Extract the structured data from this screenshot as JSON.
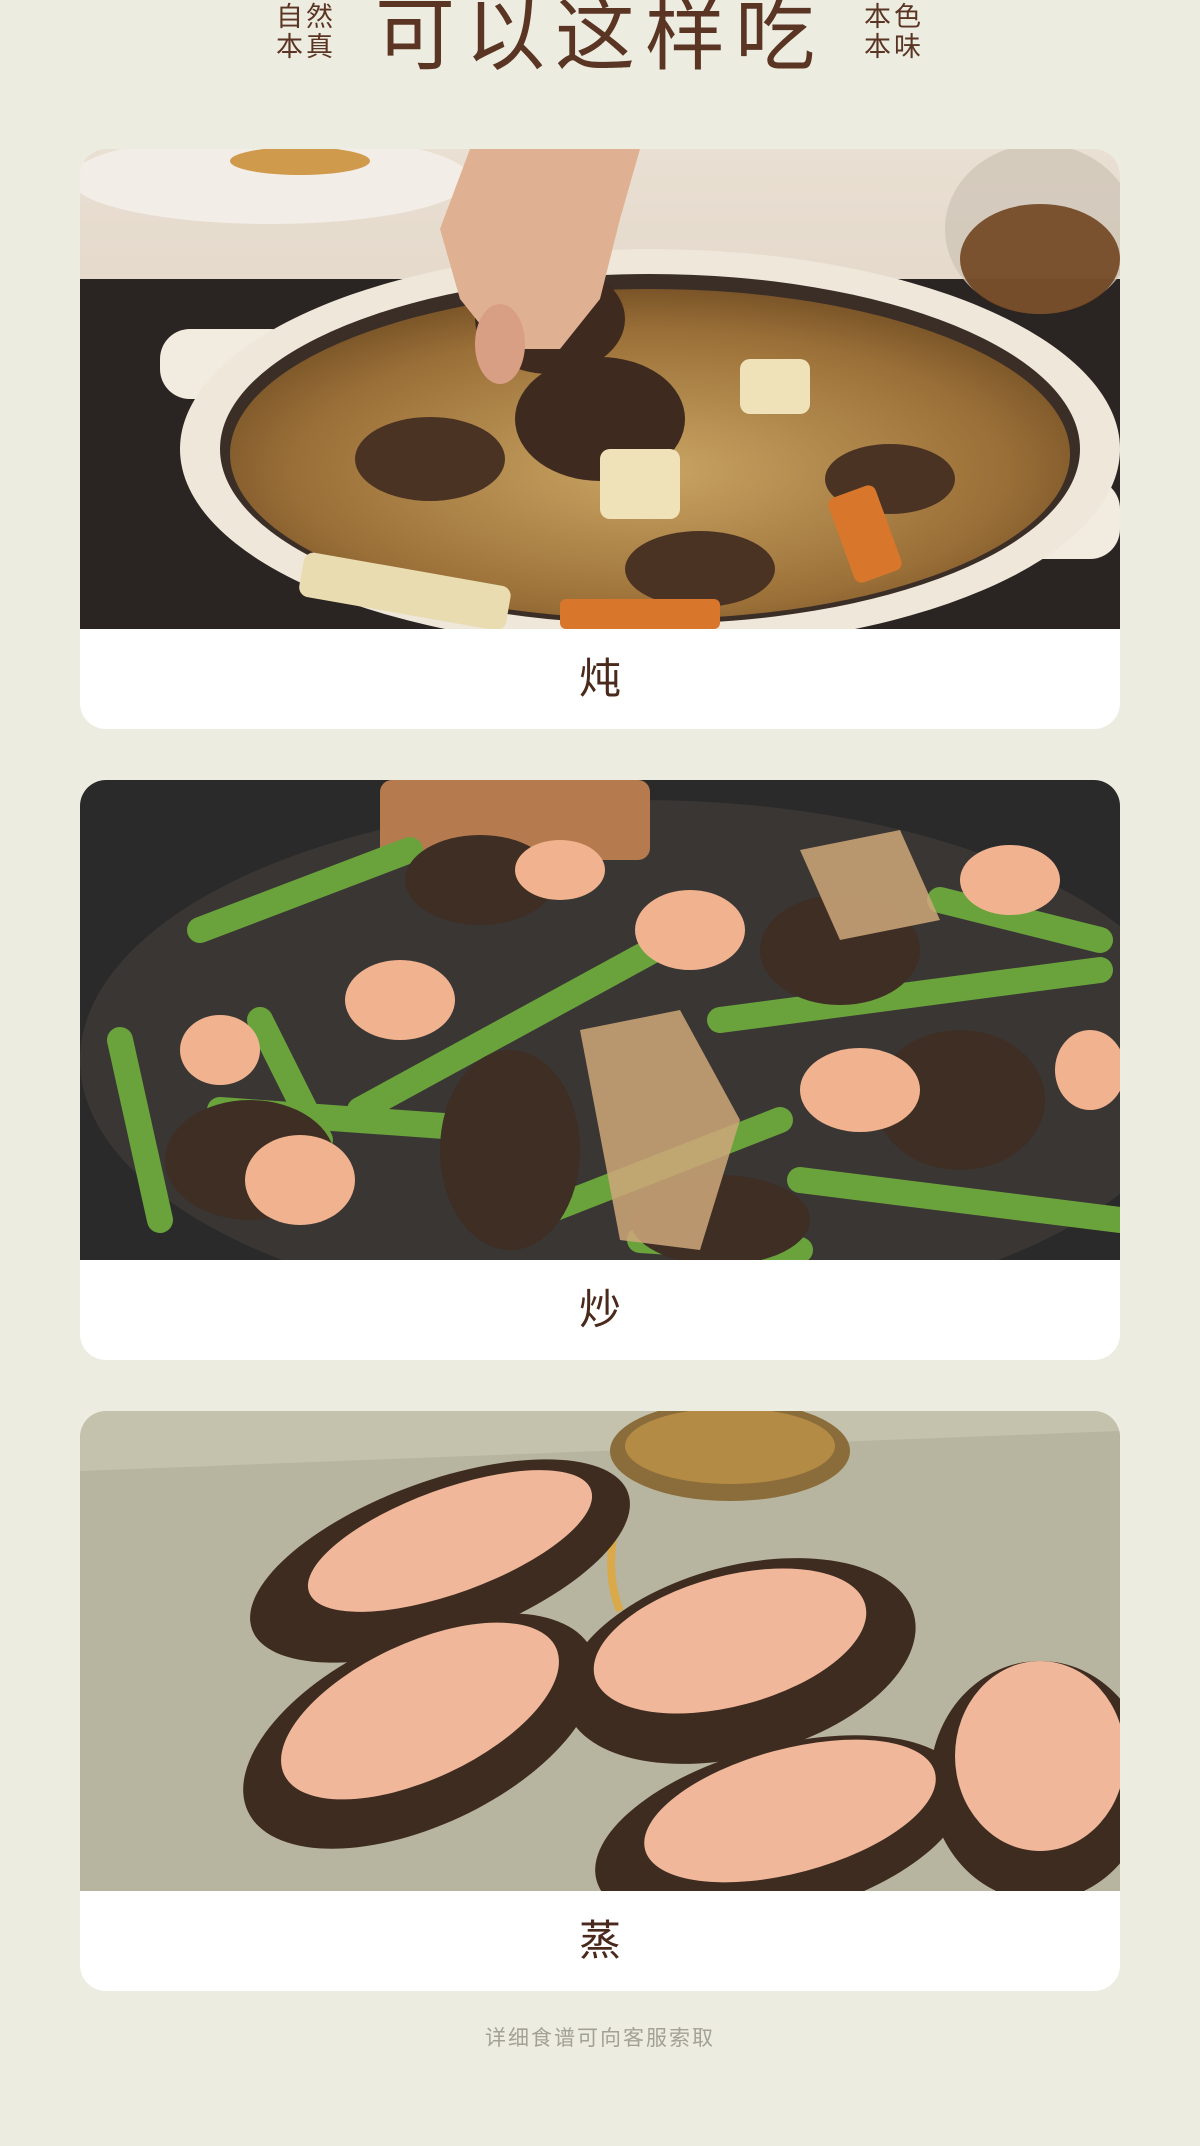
{
  "header": {
    "left_tag_line1": "自然",
    "left_tag_line2": "本真",
    "title": "可以这样吃",
    "right_tag_line1": "本色",
    "right_tag_line2": "本味"
  },
  "cards": [
    {
      "label": "炖"
    },
    {
      "label": "炒"
    },
    {
      "label": "蒸"
    }
  ],
  "footer": {
    "note": "详细食谱可向客服索取"
  },
  "colors": {
    "background": "#ecece0",
    "title_brown": "#5b3524",
    "label_brown": "#4a2a1c",
    "card_white": "#ffffff",
    "footer_gray": "#a3a196"
  }
}
